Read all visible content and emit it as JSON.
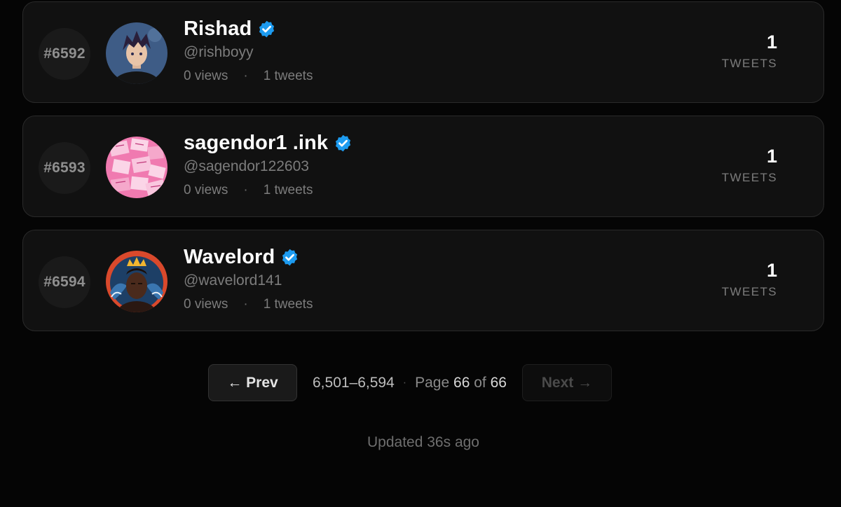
{
  "rows": [
    {
      "rank": "#6592",
      "name": "Rishad",
      "handle": "@rishboyy",
      "views": "0 views",
      "tweets_meta": "1 tweets",
      "count": "1",
      "count_label": "TWEETS",
      "avatar_icon": "anime-character-avatar"
    },
    {
      "rank": "#6593",
      "name": "sagendor1 .ink",
      "handle": "@sagendor122603",
      "views": "0 views",
      "tweets_meta": "1 tweets",
      "count": "1",
      "count_label": "TWEETS",
      "avatar_icon": "pink-papers-avatar"
    },
    {
      "rank": "#6594",
      "name": "Wavelord",
      "handle": "@wavelord141",
      "views": "0 views",
      "tweets_meta": "1 tweets",
      "count": "1",
      "count_label": "TWEETS",
      "avatar_icon": "crowned-wave-avatar"
    }
  ],
  "pagination": {
    "prev_label": "← Prev",
    "range": "6,501–6,594",
    "separator": "·",
    "page_word": "Page",
    "current_page": "66",
    "of_word": "of",
    "total_pages": "66",
    "next_label": "Next →"
  },
  "meta_separator": "·",
  "updated": "Updated 36s ago",
  "colors": {
    "background": "#050505",
    "card": "#111111",
    "verified_blue": "#1d9bf0"
  }
}
